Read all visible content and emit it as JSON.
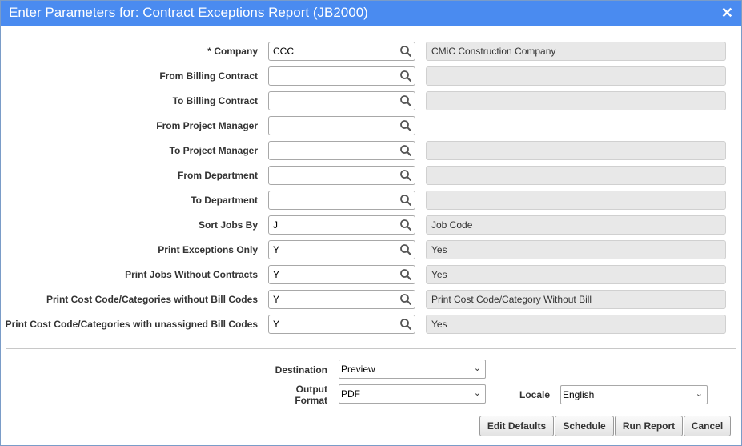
{
  "dialog": {
    "title": "Enter Parameters for: Contract Exceptions Report (JB2000)",
    "close_glyph": "✕"
  },
  "params": [
    {
      "label": "Company",
      "required_mark": "*",
      "value": "CCC",
      "description": "CMiC Construction Company",
      "has_desc_box": true
    },
    {
      "label": "From Billing Contract",
      "required_mark": "",
      "value": "",
      "description": "",
      "has_desc_box": true
    },
    {
      "label": "To Billing Contract",
      "required_mark": "",
      "value": "",
      "description": "",
      "has_desc_box": true
    },
    {
      "label": "From Project Manager",
      "required_mark": "",
      "value": "",
      "description": "",
      "has_desc_box": false
    },
    {
      "label": "To Project Manager",
      "required_mark": "",
      "value": "",
      "description": "",
      "has_desc_box": true
    },
    {
      "label": "From Department",
      "required_mark": "",
      "value": "",
      "description": "",
      "has_desc_box": true
    },
    {
      "label": "To Department",
      "required_mark": "",
      "value": "",
      "description": "",
      "has_desc_box": true
    },
    {
      "label": "Sort Jobs By",
      "required_mark": "",
      "value": "J",
      "description": "Job Code",
      "has_desc_box": true
    },
    {
      "label": "Print Exceptions Only",
      "required_mark": "",
      "value": "Y",
      "description": "Yes",
      "has_desc_box": true
    },
    {
      "label": "Print Jobs Without Contracts",
      "required_mark": "",
      "value": "Y",
      "description": "Yes",
      "has_desc_box": true
    },
    {
      "label": "Print Cost Code/Categories without Bill Codes",
      "required_mark": "",
      "value": "Y",
      "description": "Print Cost Code/Category Without Bill",
      "has_desc_box": true
    },
    {
      "label": "Print Cost Code/Categories with unassigned Bill Codes",
      "required_mark": "",
      "value": "Y",
      "description": "Yes",
      "has_desc_box": true
    }
  ],
  "output": {
    "destination_label": "Destination",
    "destination_value": "Preview",
    "format_label_line1": "Output",
    "format_label_line2": "Format",
    "format_value": "PDF",
    "locale_label": "Locale",
    "locale_value": "English",
    "chevron_glyph": "⌄"
  },
  "buttons": {
    "edit_defaults": "Edit Defaults",
    "schedule": "Schedule",
    "run_report": "Run Report",
    "cancel": "Cancel"
  },
  "colors": {
    "title_bar": "#4a8bf0",
    "desc_box": "#e8e8e8"
  },
  "icons": {
    "lov": "search-icon",
    "close": "close-icon",
    "dropdown": "chevron-down-icon"
  }
}
